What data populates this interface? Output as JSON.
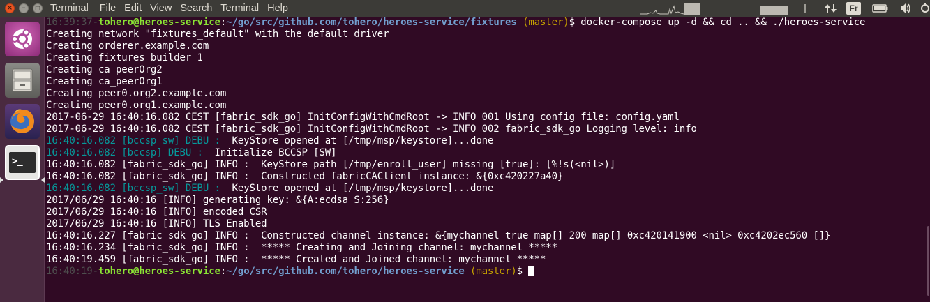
{
  "window": {
    "close_glyph": "×",
    "minimize_glyph": "–",
    "maximize_glyph": "□"
  },
  "menubar": {
    "items": [
      "Terminal",
      "File",
      "Edit",
      "View",
      "Search",
      "Terminal",
      "Help"
    ]
  },
  "tray": {
    "keyboard_layout": "Fr"
  },
  "launcher": {
    "items": [
      {
        "name": "ubuntu-dash",
        "icon": "ubuntu-logo-icon"
      },
      {
        "name": "files",
        "icon": "file-cabinet-icon"
      },
      {
        "name": "firefox",
        "icon": "firefox-icon"
      },
      {
        "name": "terminal",
        "icon": "terminal-icon",
        "prompt_glyph": ">_"
      }
    ]
  },
  "colors": {
    "terminal_bg": "#300a24",
    "prompt_user": "#8ae234",
    "prompt_path": "#729fcf",
    "prompt_branch": "#c4a000",
    "debug_cyan": "#06989a",
    "timestamp_dim": "#4e4e4e"
  },
  "terminal": {
    "lines": [
      {
        "segments": [
          {
            "text": "16:39:37-",
            "cls": "c-dim"
          },
          {
            "text": "tohero@heroes-service",
            "cls": "c-green"
          },
          {
            "text": ":",
            "cls": "c-white"
          },
          {
            "text": "~/go/src/github.com/tohero/heroes-service/fixtures",
            "cls": "c-blue"
          },
          {
            "text": " (master)",
            "cls": "c-yellow"
          },
          {
            "text": "$ docker-compose up -d && cd .. && ./heroes-service",
            "cls": "c-white"
          }
        ]
      },
      {
        "segments": [
          {
            "text": "Creating network \"fixtures_default\" with the default driver",
            "cls": "c-white"
          }
        ]
      },
      {
        "segments": [
          {
            "text": "Creating orderer.example.com",
            "cls": "c-white"
          }
        ]
      },
      {
        "segments": [
          {
            "text": "Creating fixtures_builder_1",
            "cls": "c-white"
          }
        ]
      },
      {
        "segments": [
          {
            "text": "Creating ca_peerOrg2",
            "cls": "c-white"
          }
        ]
      },
      {
        "segments": [
          {
            "text": "Creating ca_peerOrg1",
            "cls": "c-white"
          }
        ]
      },
      {
        "segments": [
          {
            "text": "Creating peer0.org2.example.com",
            "cls": "c-white"
          }
        ]
      },
      {
        "segments": [
          {
            "text": "Creating peer0.org1.example.com",
            "cls": "c-white"
          }
        ]
      },
      {
        "segments": [
          {
            "text": "2017-06-29 16:40:16.082 CEST [fabric_sdk_go] InitConfigWithCmdRoot -> INFO 001 Using config file: config.yaml",
            "cls": "c-white"
          }
        ]
      },
      {
        "segments": [
          {
            "text": "2017-06-29 16:40:16.082 CEST [fabric_sdk_go] InitConfigWithCmdRoot -> INFO 002 fabric_sdk_go Logging level: info",
            "cls": "c-white"
          }
        ]
      },
      {
        "segments": [
          {
            "text": "16:40:16.082 [bccsp_sw] DEBU :",
            "cls": "c-cyan"
          },
          {
            "text": "  KeyStore opened at [/tmp/msp/keystore]...done",
            "cls": "c-white"
          }
        ]
      },
      {
        "segments": [
          {
            "text": "16:40:16.082 [bccsp] DEBU :",
            "cls": "c-cyan"
          },
          {
            "text": "  Initialize BCCSP [SW]",
            "cls": "c-white"
          }
        ]
      },
      {
        "segments": [
          {
            "text": "16:40:16.082 [fabric_sdk_go] INFO :  KeyStore path [/tmp/enroll_user] missing [true]: [%!s(<nil>)]",
            "cls": "c-white"
          }
        ]
      },
      {
        "segments": [
          {
            "text": "16:40:16.082 [fabric_sdk_go] INFO :  Constructed fabricCAClient instance: &{0xc420227a40}",
            "cls": "c-white"
          }
        ]
      },
      {
        "segments": [
          {
            "text": "16:40:16.082 [bccsp_sw] DEBU :",
            "cls": "c-cyan"
          },
          {
            "text": "  KeyStore opened at [/tmp/msp/keystore]...done",
            "cls": "c-white"
          }
        ]
      },
      {
        "segments": [
          {
            "text": "2017/06/29 16:40:16 [INFO] generating key: &{A:ecdsa S:256}",
            "cls": "c-white"
          }
        ]
      },
      {
        "segments": [
          {
            "text": "2017/06/29 16:40:16 [INFO] encoded CSR",
            "cls": "c-white"
          }
        ]
      },
      {
        "segments": [
          {
            "text": "2017/06/29 16:40:16 [INFO] TLS Enabled",
            "cls": "c-white"
          }
        ]
      },
      {
        "segments": [
          {
            "text": "16:40:16.227 [fabric_sdk_go] INFO :  Constructed channel instance: &{mychannel true map[] 200 map[] 0xc420141900 <nil> 0xc4202ec560 []}",
            "cls": "c-white"
          }
        ]
      },
      {
        "segments": [
          {
            "text": "16:40:16.234 [fabric_sdk_go] INFO :  ***** Creating and Joining channel: mychannel *****",
            "cls": "c-white"
          }
        ]
      },
      {
        "segments": [
          {
            "text": "16:40:19.459 [fabric_sdk_go] INFO :  ***** Created and Joined channel: mychannel *****",
            "cls": "c-white"
          }
        ]
      },
      {
        "segments": [
          {
            "text": "16:40:19-",
            "cls": "c-dim"
          },
          {
            "text": "tohero@heroes-service",
            "cls": "c-green"
          },
          {
            "text": ":",
            "cls": "c-white"
          },
          {
            "text": "~/go/src/github.com/tohero/heroes-service",
            "cls": "c-blue"
          },
          {
            "text": " (master)",
            "cls": "c-yellow"
          },
          {
            "text": "$ ",
            "cls": "c-white"
          }
        ],
        "cursor": true
      }
    ]
  }
}
